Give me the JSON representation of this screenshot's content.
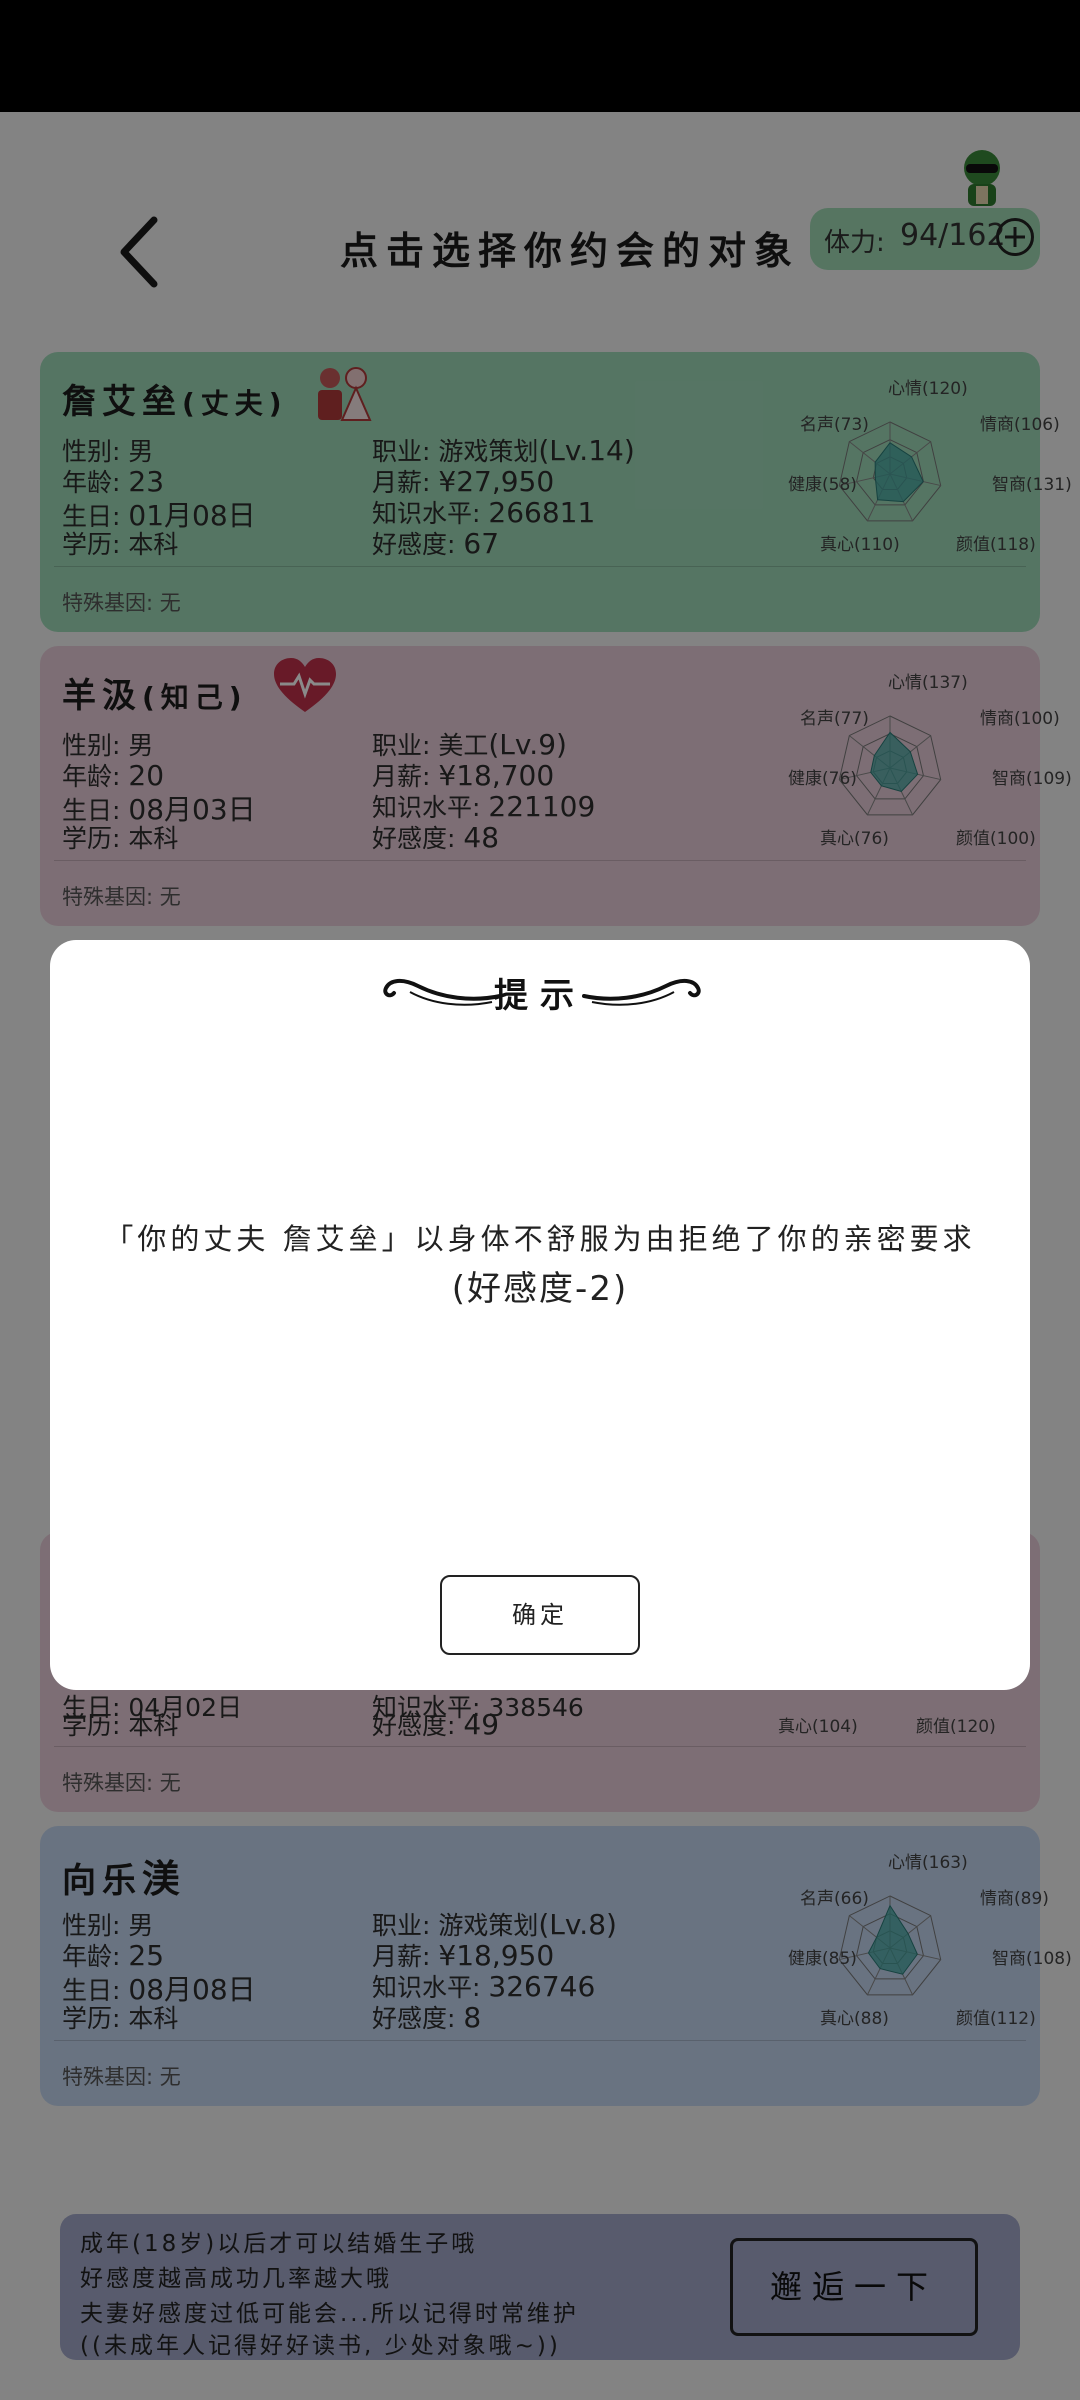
{
  "header": {
    "title": "点击选择你约会的对象",
    "stamina_label": "体力:",
    "stamina_value": "94/162"
  },
  "cards": [
    {
      "name": "詹艾垒",
      "relation": "(丈夫)",
      "badge_icon": "wedding-couple-icon",
      "gender": "性别: 男",
      "age_label": "年龄:",
      "age": "23",
      "birthday_label": "生日:",
      "birthday": "01月08日",
      "education": "学历: 本科",
      "job_label": "职业: 游戏策划",
      "job_level": "(Lv.14)",
      "salary_label": "月薪:",
      "salary": "¥27,950",
      "knowledge_label": "知识水平:",
      "knowledge": "266811",
      "affection_label": "好感度:",
      "affection": "67",
      "special": "特殊基因: 无",
      "stats": {
        "mood": "心情(120)",
        "charm": "情商(106)",
        "iq": "智商(131)",
        "value": "颜值(118)",
        "attitude": "真心(110)",
        "health": "健康(58)",
        "fame": "名声(73)"
      },
      "radar_values": [
        120,
        106,
        131,
        118,
        110,
        58,
        73
      ]
    },
    {
      "name": "羊汲",
      "relation": "(知己)",
      "badge_icon": "heart-pulse-icon",
      "gender": "性别: 男",
      "age_label": "年龄:",
      "age": "20",
      "birthday_label": "生日:",
      "birthday": "08月03日",
      "education": "学历: 本科",
      "job_label": "职业: 美工",
      "job_level": "(Lv.9)",
      "salary_label": "月薪:",
      "salary": "¥18,700",
      "knowledge_label": "知识水平:",
      "knowledge": "221109",
      "affection_label": "好感度:",
      "affection": "48",
      "special": "特殊基因: 无",
      "stats": {
        "mood": "心情(137)",
        "charm": "情商(100)",
        "iq": "智商(109)",
        "value": "颜值(100)",
        "attitude": "真心(76)",
        "health": "健康(76)",
        "fame": "名声(77)"
      },
      "radar_values": [
        137,
        100,
        109,
        100,
        76,
        76,
        77
      ]
    },
    {
      "birthday_partial": "生日: 04月02日",
      "knowledge_partial": "知识水平: 338546",
      "education": "学历: 本科",
      "affection_label": "好感度:",
      "affection": "49",
      "special": "特殊基因: 无",
      "stats": {
        "attitude": "真心(104)",
        "value": "颜值(120)"
      }
    },
    {
      "name": "向乐",
      "name_tail": "渼",
      "gender": "性别: 男",
      "age_label": "年龄:",
      "age": "25",
      "birthday_label": "生日:",
      "birthday": "08月08日",
      "education": "学历: 本科",
      "job_label": "职业: 游戏策划",
      "job_level": "(Lv.8)",
      "salary_label": "月薪:",
      "salary": "¥18,950",
      "knowledge_label": "知识水平:",
      "knowledge": "326746",
      "affection_label": "好感度:",
      "affection": "8",
      "special": "特殊基因: 无",
      "stats": {
        "mood": "心情(163)",
        "charm": "情商(89)",
        "iq": "智商(108)",
        "value": "颜值(112)",
        "attitude": "真心(88)",
        "health": "健康(85)",
        "fame": "名声(66)"
      },
      "radar_values": [
        163,
        89,
        108,
        112,
        88,
        85,
        66
      ]
    }
  ],
  "dialog": {
    "title": "提示",
    "message_line1": "「你的丈夫 詹艾垒」以身体不舒服为由拒绝了你的亲密要求",
    "message_line2": "(好感度-2)",
    "confirm_label": "确定"
  },
  "tip": {
    "line1": "成年(18岁)以后才可以结婚生子哦",
    "line2": "好感度越高成功几率越大哦",
    "line3": "夫妻好感度过低可能会...所以记得时常维护",
    "line4": "((未成年人记得好好读书, 少处对象哦~))",
    "encounter_label": "邂逅一下"
  },
  "colors": {
    "card_green": "#9ed8b8",
    "card_pink": "#e8ccd8",
    "card_blue": "#c2d4ee",
    "radar_fill": "#3fa6a0",
    "stamina_bg": "#9fd9b3"
  }
}
